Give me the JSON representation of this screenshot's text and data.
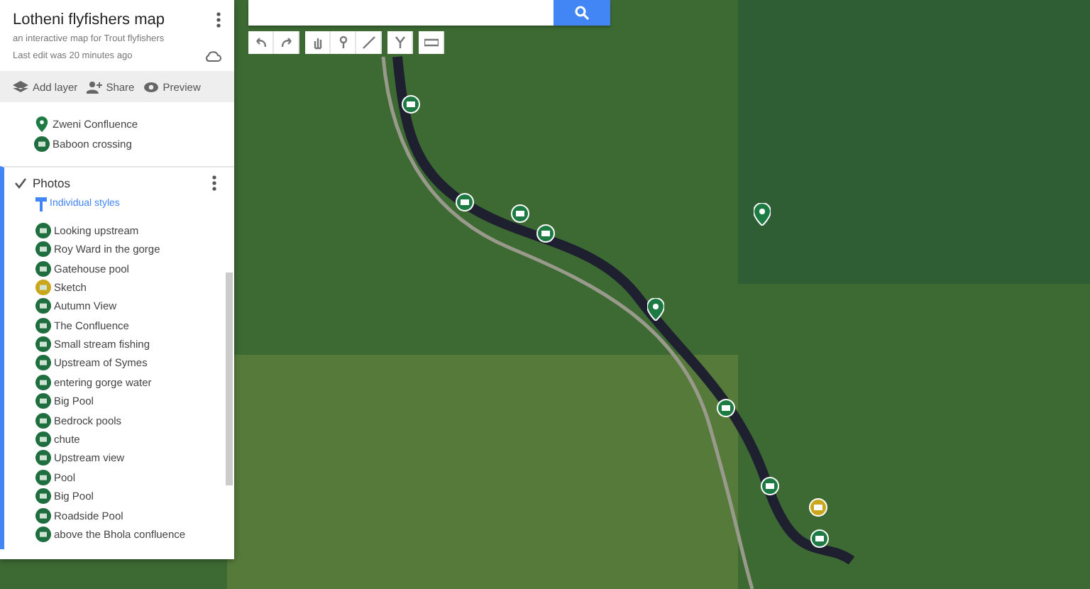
{
  "panel": {
    "title": "Lotheni flyfishers map",
    "subtitle": "an interactive map for Trout flyfishers",
    "last_edit": "Last edit was 20 minutes ago",
    "actions": [
      "Add layer",
      "Share",
      "Preview"
    ]
  },
  "layer_items": [
    {
      "label": "Zweni Confluence",
      "kind": "pin"
    },
    {
      "label": "Baboon crossing",
      "kind": "camera"
    }
  ],
  "photos_layer": {
    "title": "Photos",
    "checked": true,
    "style_link": "Individual styles",
    "items": [
      {
        "label": "Looking upstream",
        "kind": "camera"
      },
      {
        "label": "Roy Ward in the gorge",
        "kind": "camera"
      },
      {
        "label": "Gatehouse pool",
        "kind": "camera"
      },
      {
        "label": "Sketch",
        "kind": "sketch"
      },
      {
        "label": "Autumn View",
        "kind": "camera"
      },
      {
        "label": "The Confluence",
        "kind": "camera"
      },
      {
        "label": "Small stream fishing",
        "kind": "camera"
      },
      {
        "label": "Upstream of Symes",
        "kind": "camera"
      },
      {
        "label": "entering gorge water",
        "kind": "camera"
      },
      {
        "label": "Big Pool",
        "kind": "camera"
      },
      {
        "label": "Bedrock pools",
        "kind": "camera"
      },
      {
        "label": "chute",
        "kind": "camera"
      },
      {
        "label": "Upstream view",
        "kind": "camera"
      },
      {
        "label": "Pool",
        "kind": "camera"
      },
      {
        "label": "Big Pool",
        "kind": "camera"
      },
      {
        "label": "Roadside Pool",
        "kind": "camera"
      },
      {
        "label": "above the Bhola confluence",
        "kind": "camera"
      }
    ]
  }
}
